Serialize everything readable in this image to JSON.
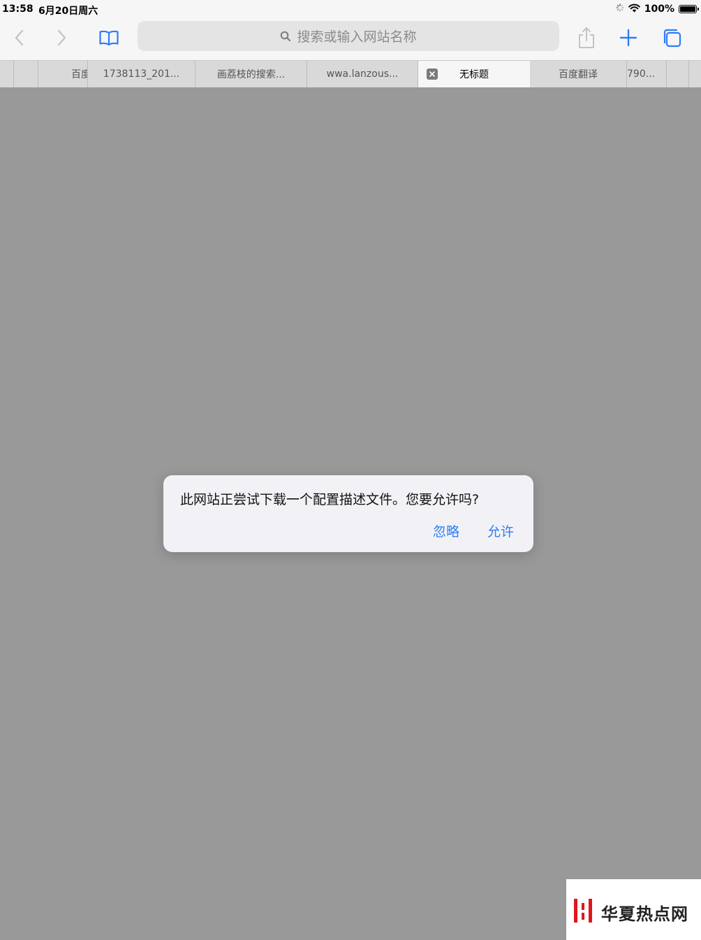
{
  "status": {
    "time": "13:58",
    "date": "6月20日周六",
    "battery_text": "100%",
    "battery_level": 1.0
  },
  "toolbar": {
    "address_placeholder": "搜索或输入网站名称",
    "accent_color": "#2f7cf6"
  },
  "tabs": [
    {
      "label": ""
    },
    {
      "label": ""
    },
    {
      "label": "百度"
    },
    {
      "label": "1738113_201..."
    },
    {
      "label": "画荔枝的搜索..."
    },
    {
      "label": "wwa.lanzous..."
    },
    {
      "label": "无标题",
      "active": true
    },
    {
      "label": "百度翻译"
    },
    {
      "label": "790..."
    },
    {
      "label": ""
    },
    {
      "label": ""
    }
  ],
  "dialog": {
    "message": "此网站正尝试下载一个配置描述文件。您要允许吗?",
    "ignore_label": "忽略",
    "allow_label": "允许"
  },
  "watermark": {
    "text": "华夏热点网"
  }
}
